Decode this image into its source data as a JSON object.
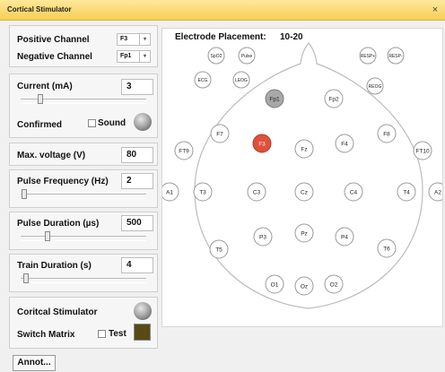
{
  "window": {
    "title": "Cortical Stimulator",
    "close_glyph": "×"
  },
  "channels": {
    "positive_label": "Positive Channel",
    "positive_value": "F3",
    "negative_label": "Negative Channel",
    "negative_value": "Fp1",
    "dropdown_glyph": "▾"
  },
  "current": {
    "label": "Current (mA)",
    "value": "3",
    "slider_fraction": 0.14,
    "confirmed_label": "Confirmed",
    "sound_label": "Sound",
    "sound_checked": false
  },
  "max_voltage": {
    "label": "Max. voltage (V)",
    "value": "80"
  },
  "pulse_frequency": {
    "label": "Pulse Frequency (Hz)",
    "value": "2",
    "slider_fraction": 0.01
  },
  "pulse_duration": {
    "label": "Pulse Duration (µs)",
    "value": "500",
    "slider_fraction": 0.2
  },
  "train_duration": {
    "label": "Train Duration (s)",
    "value": "4",
    "slider_fraction": 0.02
  },
  "cortical": {
    "label": "Coritcal Stimulator"
  },
  "switch_matrix": {
    "label": "Switch Matrix",
    "test_label": "Test",
    "test_checked": false,
    "indicator_color": "#5a4a15"
  },
  "annot_button": "Annot...",
  "placement": {
    "label": "Electrode Placement:",
    "system": "10-20",
    "active_positive_color": "#e0503a",
    "active_negative_color": "#a8a8a8",
    "electrodes": [
      "SpO2",
      "Pulse",
      "RESP+",
      "RESP-",
      "ECG",
      "LEOG",
      "REOG",
      "Fp1",
      "Fp2",
      "F7",
      "F3",
      "Fz",
      "F4",
      "F8",
      "FT9",
      "FT10",
      "A1",
      "T3",
      "C3",
      "Cz",
      "C4",
      "T4",
      "A2",
      "T5",
      "P3",
      "Pz",
      "P4",
      "T6",
      "O1",
      "Oz",
      "O2"
    ]
  }
}
